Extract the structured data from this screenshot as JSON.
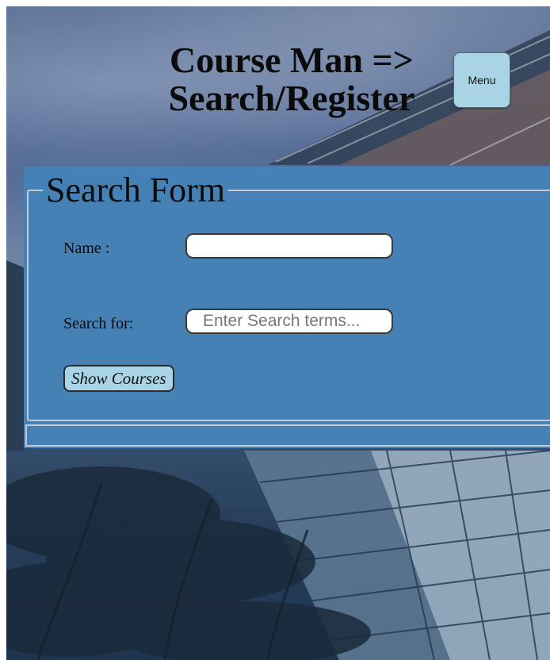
{
  "header": {
    "title_line1": "Course Man =>",
    "title_line2": "Search/Register",
    "menu_label": "Menu"
  },
  "search_form": {
    "legend": "Search Form",
    "name_label": "Name :",
    "name_value": "",
    "search_label": "Search for:",
    "search_placeholder": "Enter Search terms...",
    "show_courses_label": "Show Courses"
  },
  "colors": {
    "panel": "#4681b6",
    "button": "#a9d4e6"
  },
  "icons": {
    "background": "campus-building-photo"
  }
}
